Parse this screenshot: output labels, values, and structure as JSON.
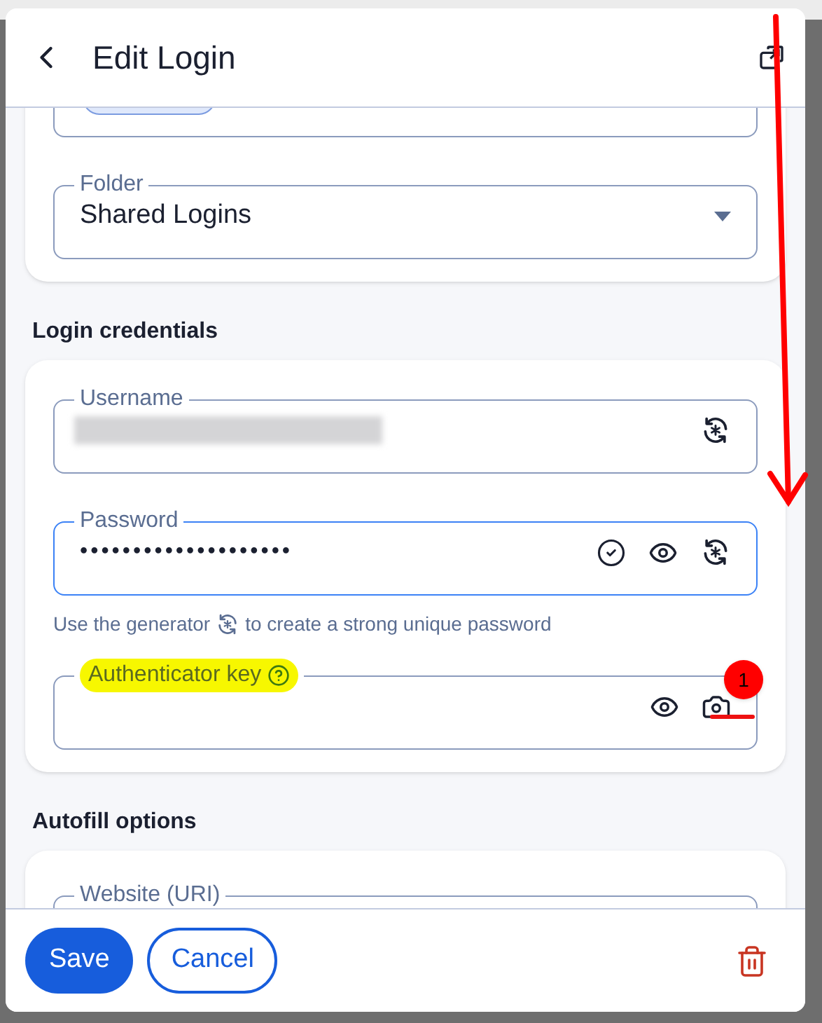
{
  "header": {
    "title": "Edit Login"
  },
  "item_details": {
    "folder": {
      "label": "Folder",
      "value": "Shared Logins"
    }
  },
  "login_credentials": {
    "heading": "Login credentials",
    "username": {
      "label": "Username",
      "redacted": true
    },
    "password": {
      "label": "Password",
      "value": "••••••••••••••••••••",
      "focused": true
    },
    "helper": {
      "before": "Use the generator",
      "after": "to create a strong unique password"
    },
    "authenticator": {
      "label": "Authenticator key",
      "highlighted": true,
      "badge": "1"
    }
  },
  "autofill": {
    "heading": "Autofill options",
    "website": {
      "label": "Website (URI)"
    }
  },
  "footer": {
    "buttons": [
      "Save",
      "Cancel"
    ]
  }
}
